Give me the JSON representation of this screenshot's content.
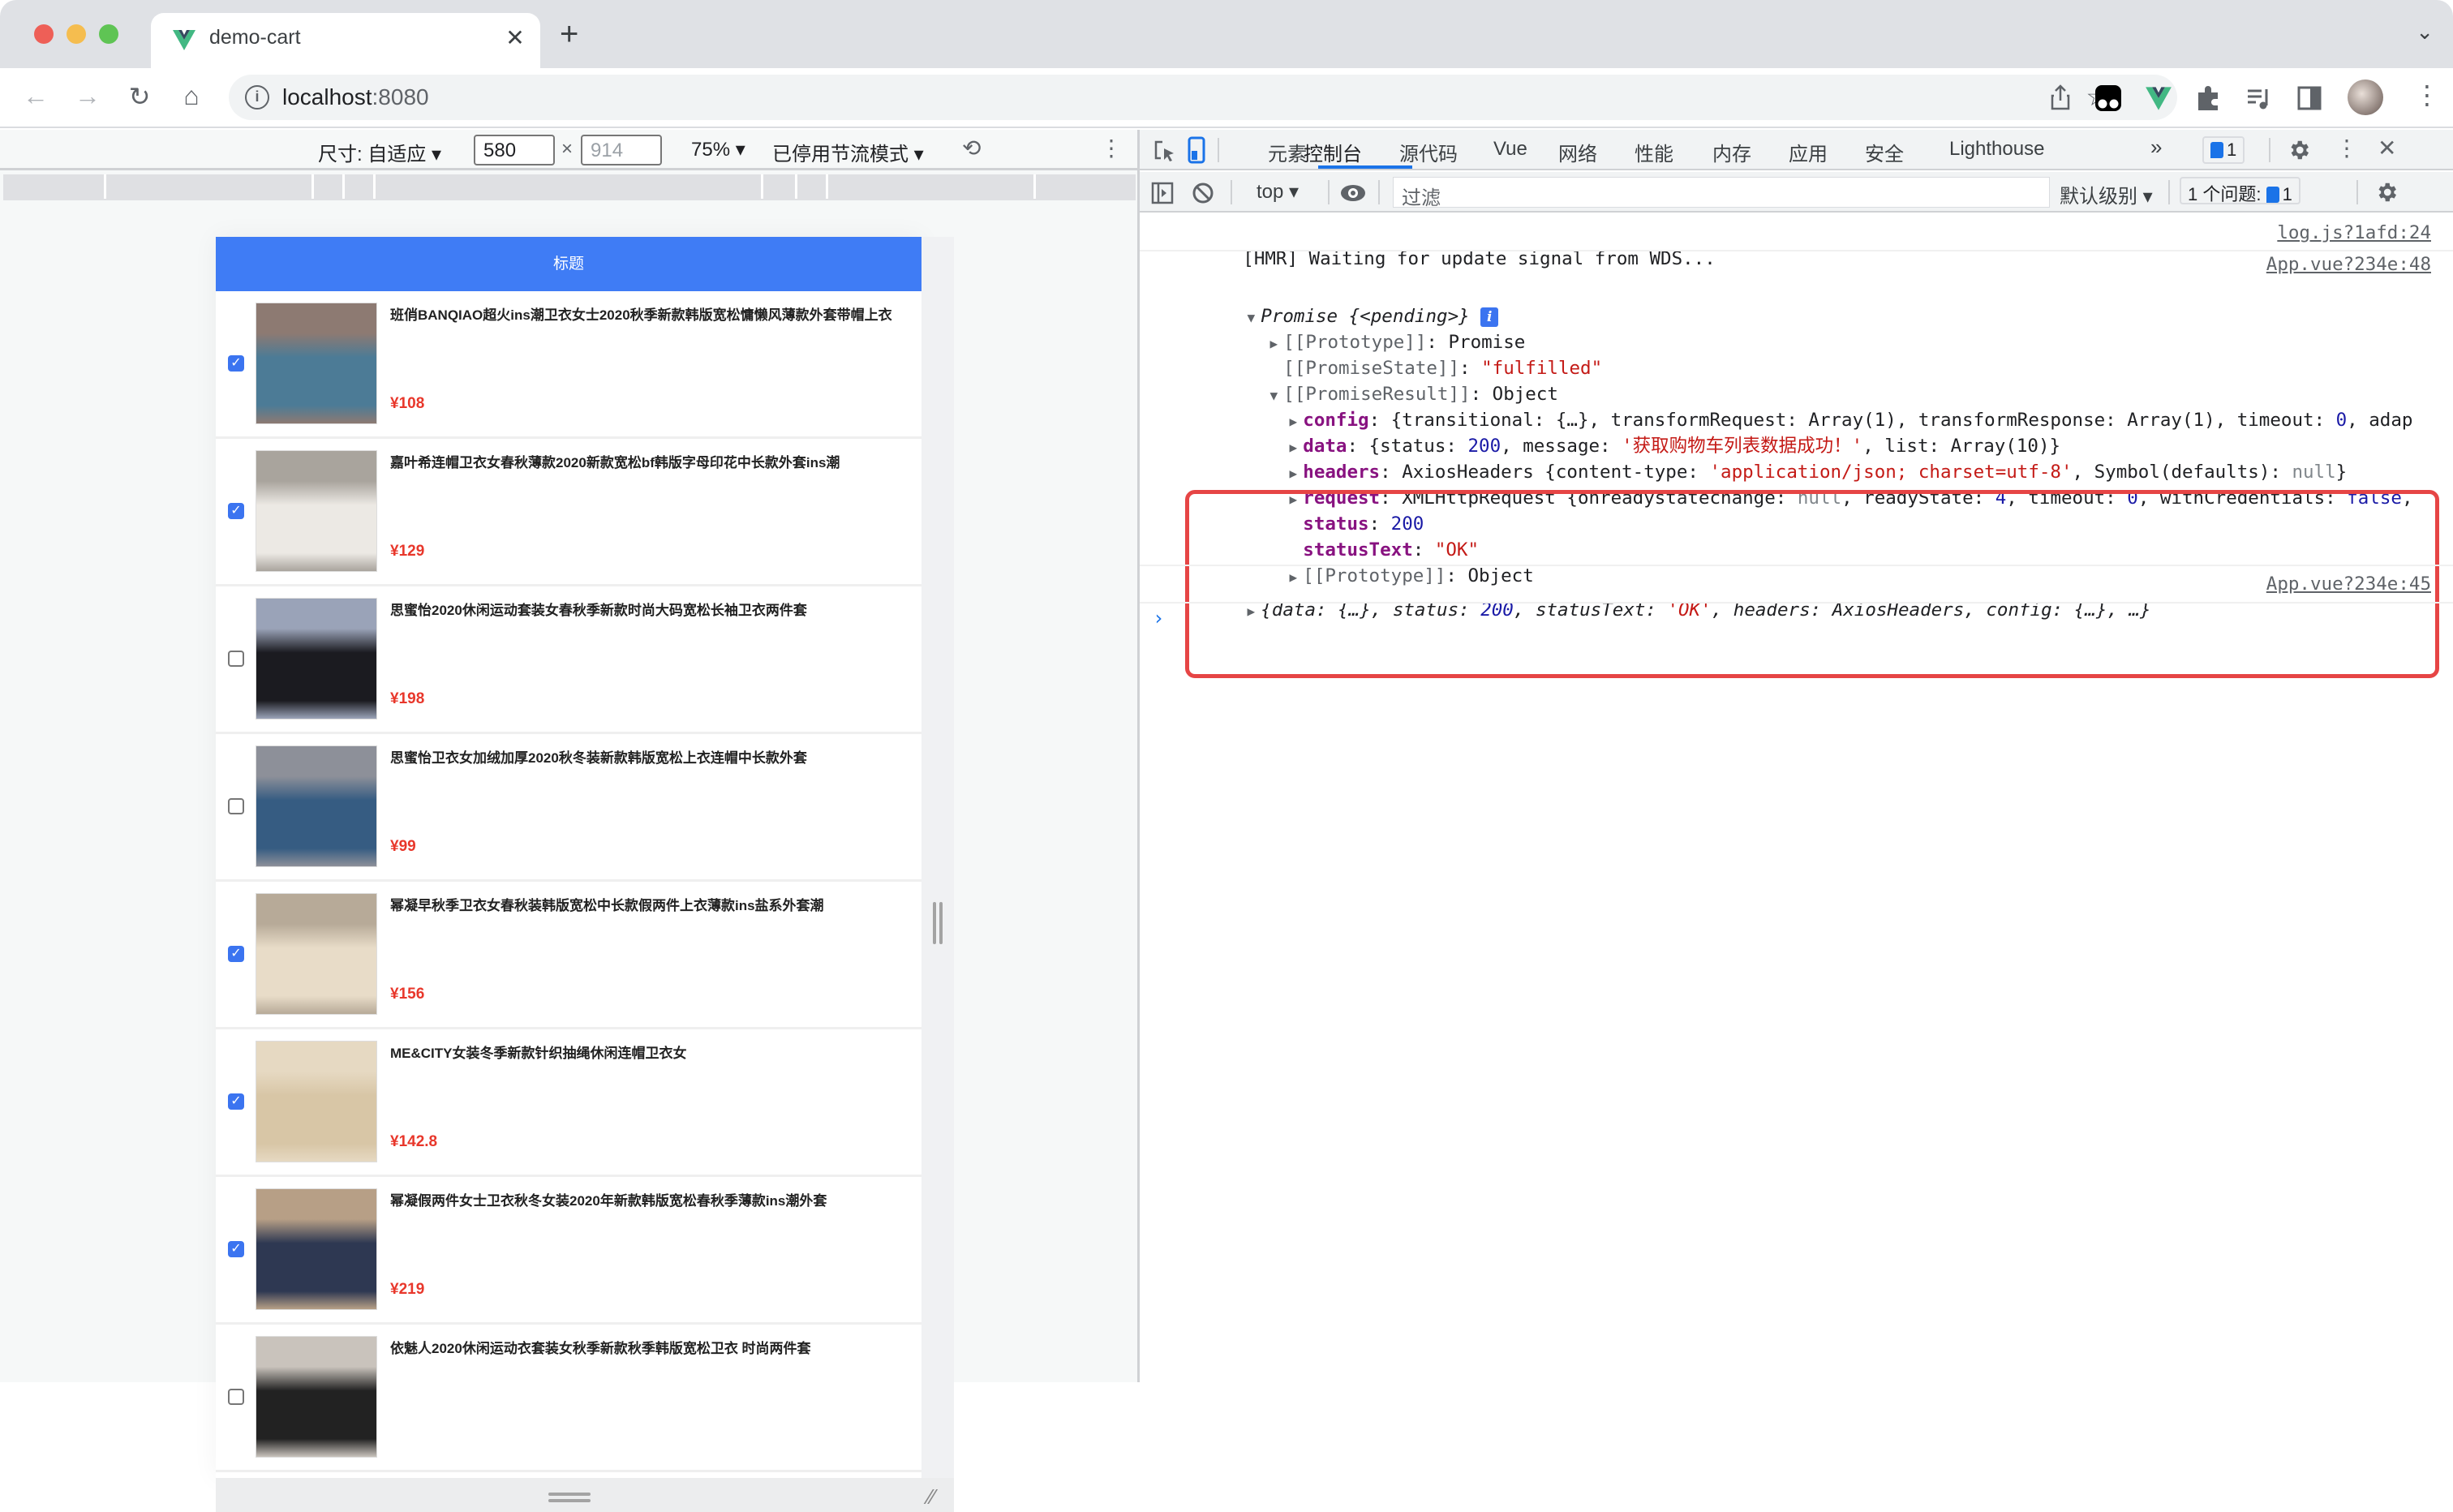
{
  "browser": {
    "tab_title": "demo-cart",
    "tab_close": "✕",
    "new_tab": "+",
    "tab_list": "⌄",
    "url_host": "localhost",
    "url_port": ":8080",
    "nav": {
      "back": "←",
      "forward": "→",
      "reload": "↻",
      "home": "⌂"
    },
    "icons": [
      "share-icon",
      "bookmark-star-icon",
      "tampermonkey-extension-icon",
      "vue-devtools-extension-icon",
      "extensions-puzzle-icon",
      "media-control-icon",
      "side-panel-icon",
      "profile-avatar",
      "more-menu-icon"
    ]
  },
  "device_toolbar": {
    "dimensions_label": "尺寸: 自适应 ▾",
    "width": "580",
    "times": "×",
    "height_placeholder": "914",
    "zoom": "75% ▾",
    "throttling": "已停用节流模式 ▾",
    "rotate": "⟲",
    "more": "⋮"
  },
  "page": {
    "header_title": "标题",
    "colors": {
      "header": "#3f7cf5",
      "price": "#e8372b",
      "checkbox": "#3b74f0"
    },
    "items": [
      {
        "checked": true,
        "name": "班俏BANQIAO超火ins潮卫衣女士2020秋季新款韩版宽松慵懒风薄款外套带帽上衣",
        "price": "¥108",
        "img_color": "#8d7a72",
        "img_accent": "#4c7b96"
      },
      {
        "checked": true,
        "name": "嘉叶希连帽卫衣女春秋薄款2020新款宽松bf韩版字母印花中长款外套ins潮",
        "price": "¥129",
        "img_color": "#a9a49d",
        "img_accent": "#ece9e4"
      },
      {
        "checked": false,
        "name": "思蜜怡2020休闲运动套装女春秋季新款时尚大码宽松长袖卫衣两件套",
        "price": "¥198",
        "img_color": "#9aa3b8",
        "img_accent": "#1b1b20"
      },
      {
        "checked": false,
        "name": "思蜜怡卫衣女加绒加厚2020秋冬装新款韩版宽松上衣连帽中长款外套",
        "price": "¥99",
        "img_color": "#8d9099",
        "img_accent": "#365c82"
      },
      {
        "checked": true,
        "name": "幂凝早秋季卫衣女春秋装韩版宽松中长款假两件上衣薄款ins盐系外套潮",
        "price": "¥156",
        "img_color": "#b7aa98",
        "img_accent": "#e8dcc8"
      },
      {
        "checked": true,
        "name": "ME&CITY女装冬季新款针织抽绳休闲连帽卫衣女",
        "price": "¥142.8",
        "img_color": "#e6d9c2",
        "img_accent": "#d8c6a6"
      },
      {
        "checked": true,
        "name": "幂凝假两件女士卫衣秋冬女装2020年新款韩版宽松春秋季薄款ins潮外套",
        "price": "¥219",
        "img_color": "#b79f86",
        "img_accent": "#2e3852"
      },
      {
        "checked": false,
        "name": "依魅人2020休闲运动衣套装女秋季新款秋季韩版宽松卫衣 时尚两件套",
        "price": "",
        "img_color": "#c9c3bc",
        "img_accent": "#222"
      }
    ]
  },
  "devtools": {
    "tabs": [
      "元素",
      "控制台",
      "源代码",
      "Vue",
      "网络",
      "性能",
      "内存",
      "应用",
      "安全",
      "Lighthouse"
    ],
    "active_tab": "控制台",
    "overflow": "»",
    "issues_count": "1",
    "filter": {
      "context": "top ▾",
      "placeholder": "过滤",
      "level": "默认级别 ▾",
      "issues_label": "1 个问题:",
      "issues_count": "1"
    },
    "console": {
      "hmr": "[HMR] Waiting for update signal from WDS...",
      "hmr_src": "log.js?1afd:24",
      "promise_src": "App.vue?234e:48",
      "promise_head_a": "Promise ",
      "promise_head_b": "{<pending>}",
      "proto_promise_key": "[[Prototype]]",
      "proto_promise_val": "Promise",
      "state_key": "[[PromiseState]]",
      "state_val": "\"fulfilled\"",
      "result_key": "[[PromiseResult]]",
      "result_val": "Object",
      "config_key": "config",
      "config_val": "{transitional: {…}, transformRequest: Array(1), transformResponse: Array(1), timeout: ",
      "config_timeout": "0",
      "config_tail": ", adap",
      "data_key": "data",
      "data_a": "{status: ",
      "data_status": "200",
      "data_b": ", message: ",
      "data_message": "'获取购物车列表数据成功！'",
      "data_c": ", list: Array(10)}",
      "headers_key": "headers",
      "headers_a": "AxiosHeaders {content-type: ",
      "headers_ct": "'application/json; charset=utf-8'",
      "headers_b": ", Symbol(defaults): ",
      "headers_null": "null",
      "headers_c": "}",
      "request_key": "request",
      "request_a": "XMLHttpRequest {onreadystatechange: ",
      "request_null": "null",
      "request_b": ", readyState: ",
      "request_rs": "4",
      "request_c": ", timeout: ",
      "request_to": "0",
      "request_d": ", withCredentials: ",
      "request_wc": "false",
      "request_e": ",",
      "status_key": "status",
      "status_val": "200",
      "statustext_key": "statusText",
      "statustext_val": "\"OK\"",
      "proto_obj_key": "[[Prototype]]",
      "proto_obj_val": "Object",
      "summary_a": "{data: {…}, status: ",
      "summary_status": "200",
      "summary_b": ", statusText: ",
      "summary_st": "'OK'",
      "summary_c": ", headers: AxiosHeaders, config: {…}, …}",
      "summary_src": "App.vue?234e:45",
      "prompt": "›"
    }
  }
}
